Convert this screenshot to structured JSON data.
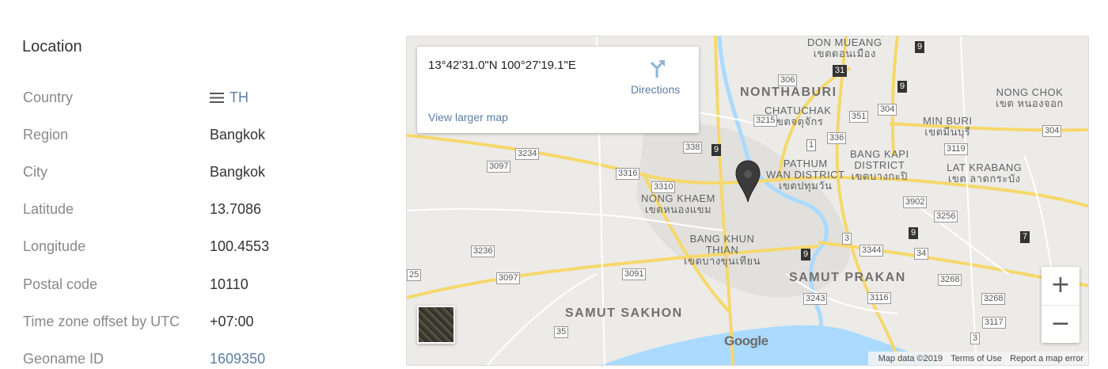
{
  "section": {
    "title": "Location"
  },
  "rows": [
    {
      "label": "Country",
      "value": "TH"
    },
    {
      "label": "Region",
      "value": "Bangkok"
    },
    {
      "label": "City",
      "value": "Bangkok"
    },
    {
      "label": "Latitude",
      "value": "13.7086"
    },
    {
      "label": "Longitude",
      "value": "100.4553"
    },
    {
      "label": "Postal code",
      "value": "10110"
    },
    {
      "label": "Time zone offset by UTC",
      "value": "+07:00"
    },
    {
      "label": "Geoname ID",
      "value": "1609350"
    }
  ],
  "map": {
    "card": {
      "coordinates": "13°42'31.0\"N 100°27'19.1\"E",
      "directions": "Directions",
      "view_larger": "View larger map"
    },
    "labels": {
      "don_mueang": "DON MUEANG",
      "don_mueang_th": "เขตดอนเมือง",
      "nonthaburi": "NONTHABURI",
      "chatuchak": "CHATUCHAK",
      "chatuchak_th": "เขตจตุจักร",
      "pathum_wan": "PATHUM",
      "pathum_wan2": "WAN DISTRICT",
      "pathum_wan_th": "เขตปทุมวัน",
      "bang_kapi": "BANG KAPI",
      "bang_kapi2": "DISTRICT",
      "bang_kapi_th": "เขตบางกะปิ",
      "nong_chok": "NONG CHOK",
      "nong_chok_th": "เขต หนองจอก",
      "min_buri": "MIN BURI",
      "min_buri_th": "เขตมีนบุรี",
      "lat_krabang": "LAT KRABANG",
      "lat_krabang_th": "เขต ลาดกระบัง",
      "nong_khaem": "NONG KHAEM",
      "nong_khaem_th": "เขตหนองแขม",
      "bang_khun_thian": "BANG KHUN",
      "bang_khun_thian2": "THIAN",
      "bang_khun_thian_th": "เขตบางขุนเทียน",
      "samut_prakan": "SAMUT PRAKAN",
      "samut_sakhon": "SAMUT SAKHON"
    },
    "shields": [
      "306",
      "31",
      "9",
      "3215",
      "351",
      "304",
      "1",
      "336",
      "3119",
      "304",
      "338",
      "9",
      "3234",
      "3097",
      "3316",
      "3310",
      "3902",
      "3256",
      "7",
      "3",
      "9",
      "3344",
      "34",
      "3236",
      "3097",
      "3091",
      "3268",
      "3243",
      "3116",
      "3268",
      "3117",
      "35",
      "3",
      "25",
      "9",
      "9"
    ],
    "zoom_in": "+",
    "zoom_out": "−",
    "google": "Google",
    "footer": {
      "map_data": "Map data ©2019",
      "terms": "Terms of Use",
      "report": "Report a map error"
    },
    "colors": {
      "road": "#f6d86b",
      "water": "#aadaff",
      "land": "#ecebe8",
      "link": "#5b7ea6"
    }
  }
}
